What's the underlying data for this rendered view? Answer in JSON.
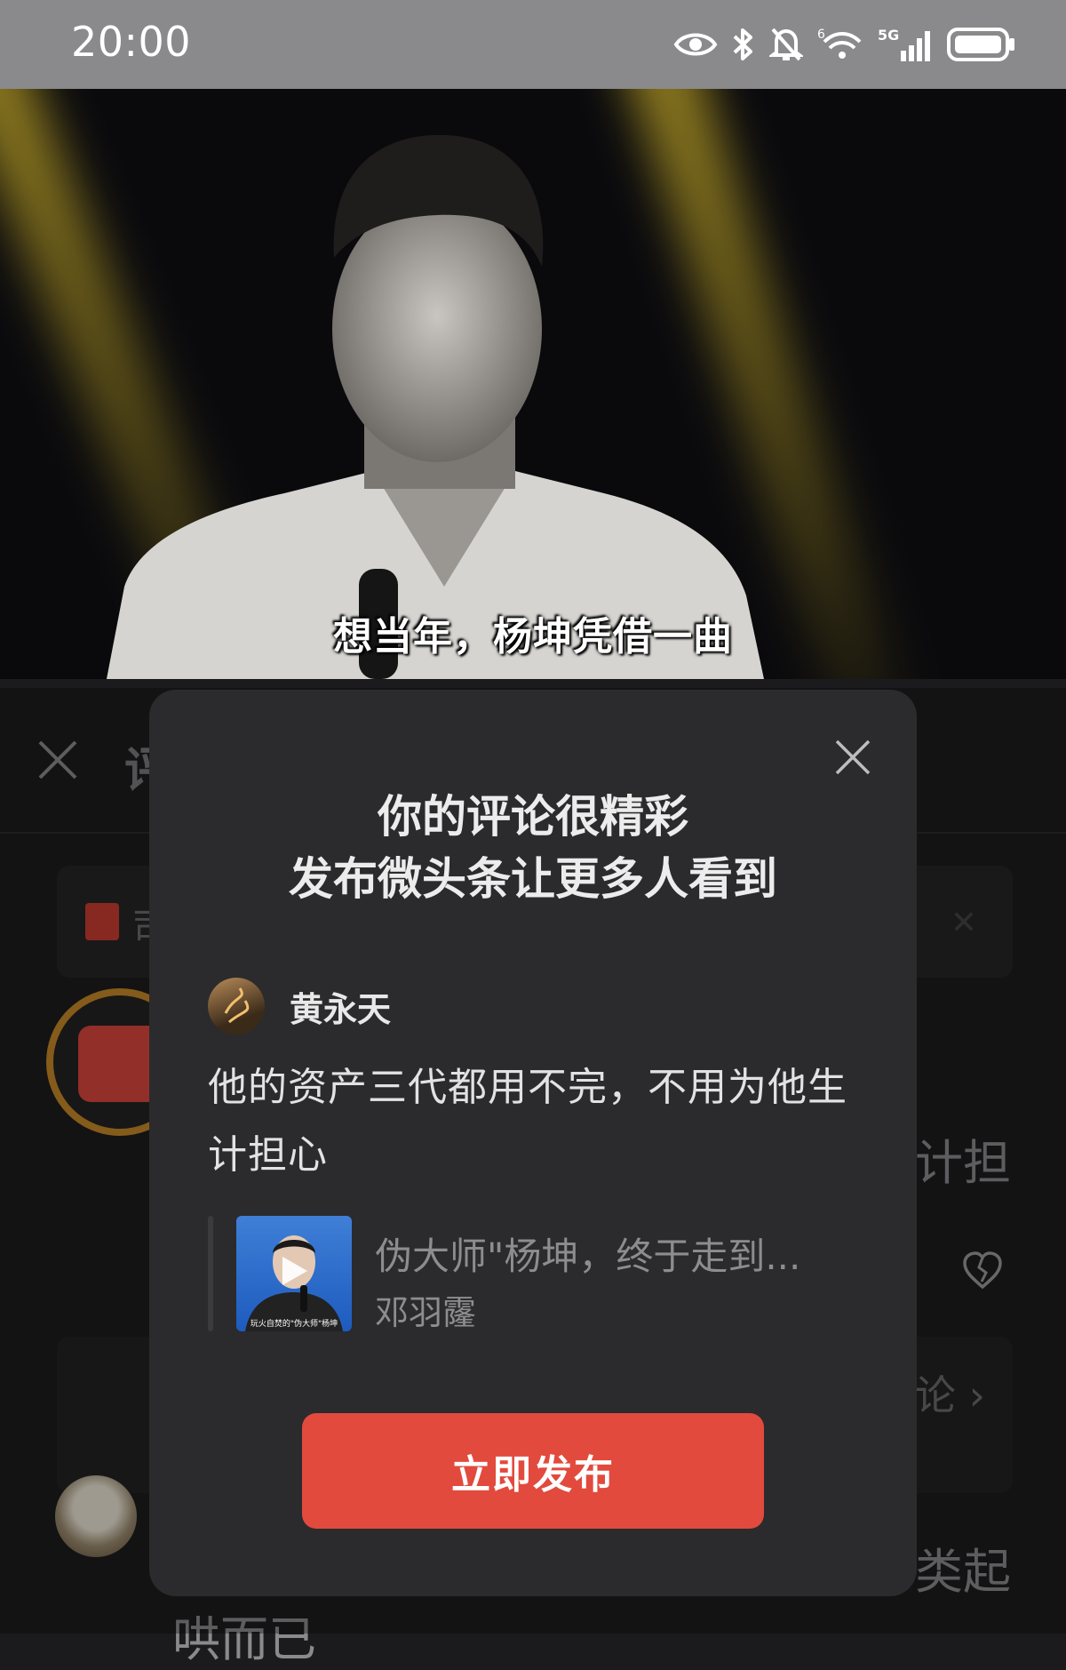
{
  "status_bar": {
    "time": "20:00",
    "network": "5G",
    "icons": [
      "eye-icon",
      "bluetooth-icon",
      "mute-bell-icon",
      "wifi-icon",
      "signal-icon",
      "battery-icon"
    ]
  },
  "video": {
    "subtitle": "想当年，杨坤凭借一曲"
  },
  "background_sheet": {
    "title_partial": "评",
    "banner_partial": "司",
    "text_fragment_1": "计担",
    "text_fragment_2": "论 ›",
    "text_fragment_3": "类起",
    "text_fragment_4": "哄而已"
  },
  "modal": {
    "title_line1": "你的评论很精彩",
    "title_line2": "发布微头条让更多人看到",
    "author_name": "黄永天",
    "comment": "他的资产三代都用不完，不用为他生计担心",
    "quoted_article": {
      "title": "伪大师\"杨坤，终于走到...",
      "author": "邓羽霳",
      "thumb_caption": "玩火自焚的\"伪大师\"杨坤"
    },
    "publish_label": "立即发布"
  },
  "colors": {
    "status_bar": "#8a8a8c",
    "sheet_background": "#1c1c1e",
    "modal_background": "#2b2b2d",
    "publish_button": "#e24a3d",
    "red_packet_ring": "#c58728"
  }
}
